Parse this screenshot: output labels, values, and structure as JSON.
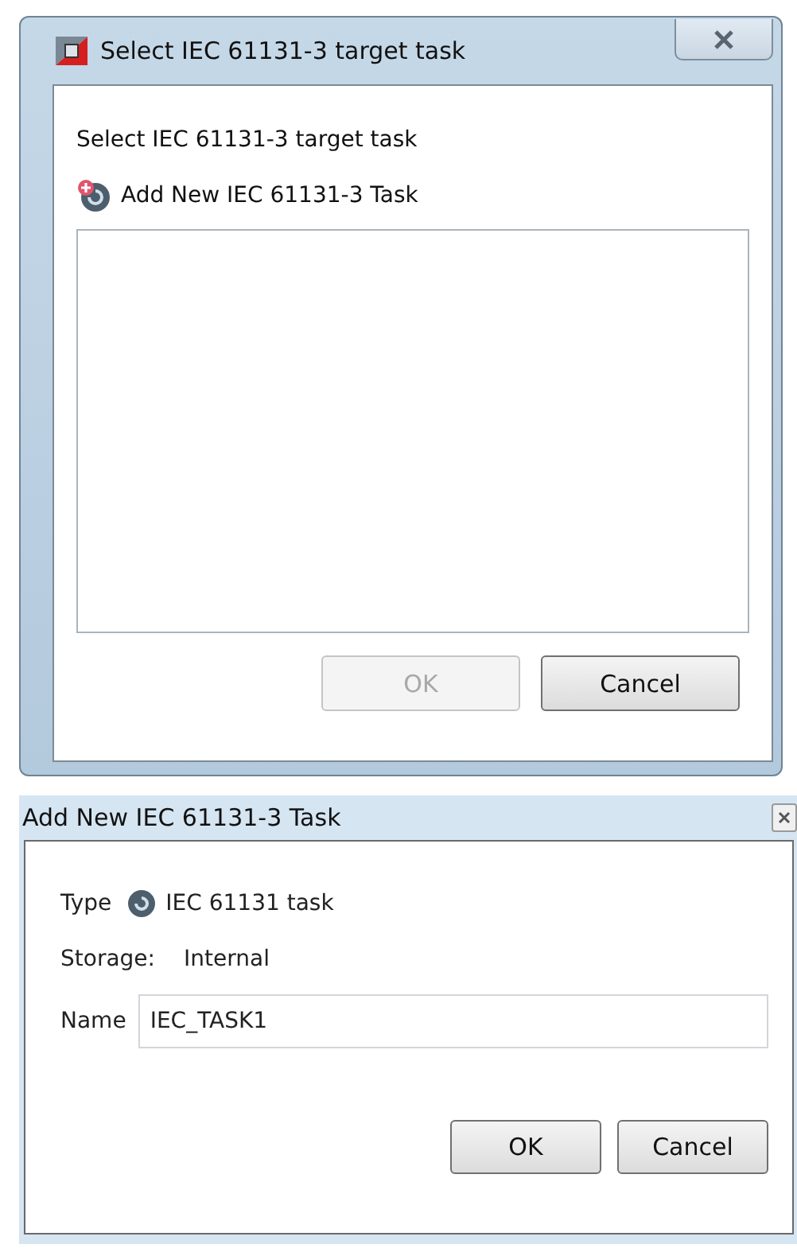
{
  "select_dialog": {
    "title": "Select IEC 61131-3 target task",
    "prompt": "Select IEC 61131-3 target task",
    "add_task_link": "Add New IEC 61131-3 Task",
    "buttons": [
      {
        "label": "OK",
        "disabled": true
      },
      {
        "label": "Cancel",
        "disabled": false
      }
    ]
  },
  "add_task_dialog": {
    "title": "Add New IEC 61131-3 Task",
    "fields": [
      {
        "kind": "type",
        "label": "Type",
        "value": "IEC 61131 task"
      },
      {
        "kind": "static",
        "label": "Storage:",
        "value": "Internal"
      },
      {
        "kind": "input",
        "label": "Name",
        "value": "IEC_TASK1"
      }
    ],
    "buttons": [
      {
        "label": "OK",
        "disabled": false
      },
      {
        "label": "Cancel",
        "disabled": false
      }
    ]
  }
}
